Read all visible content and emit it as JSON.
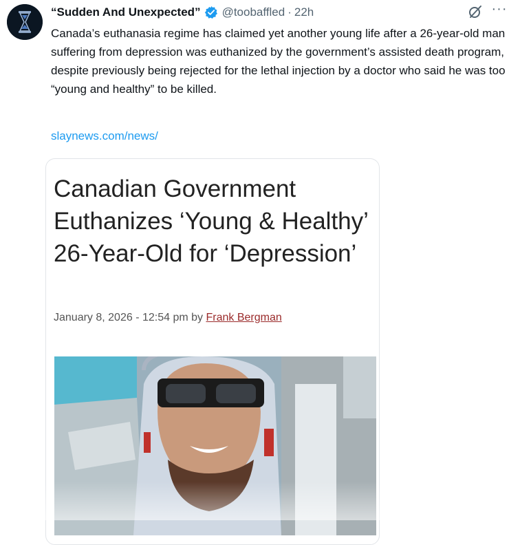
{
  "tweet": {
    "display_name": "“Sudden And Unexpected”",
    "handle": "@toobaffled",
    "separator": "·",
    "time": "22h",
    "more_label": "···",
    "text": "Canada’s euthanasia regime has claimed yet another young life after a 26-year-old man suffering from depression was euthanized by the government’s assisted death program, despite previously being rejected for the lethal injection by a doctor who said he was too “young and healthy” to be killed.",
    "link": "slaynews.com/news/",
    "icons": [
      "avatar-hourglass",
      "verified-badge-icon",
      "grok-icon",
      "more-icon"
    ]
  },
  "card": {
    "headline": "Canadian Government Euthanizes ‘Young & Healthy’ 26-Year-Old for ‘Depression’",
    "date_prefix": "January 8, 2026 - 12:54 pm by ",
    "author": "Frank Bergman"
  },
  "colors": {
    "link": "#1d9bf0",
    "verified": "#1d9bf0",
    "secondary_text": "#536471",
    "author_link": "#9a2a2a"
  }
}
